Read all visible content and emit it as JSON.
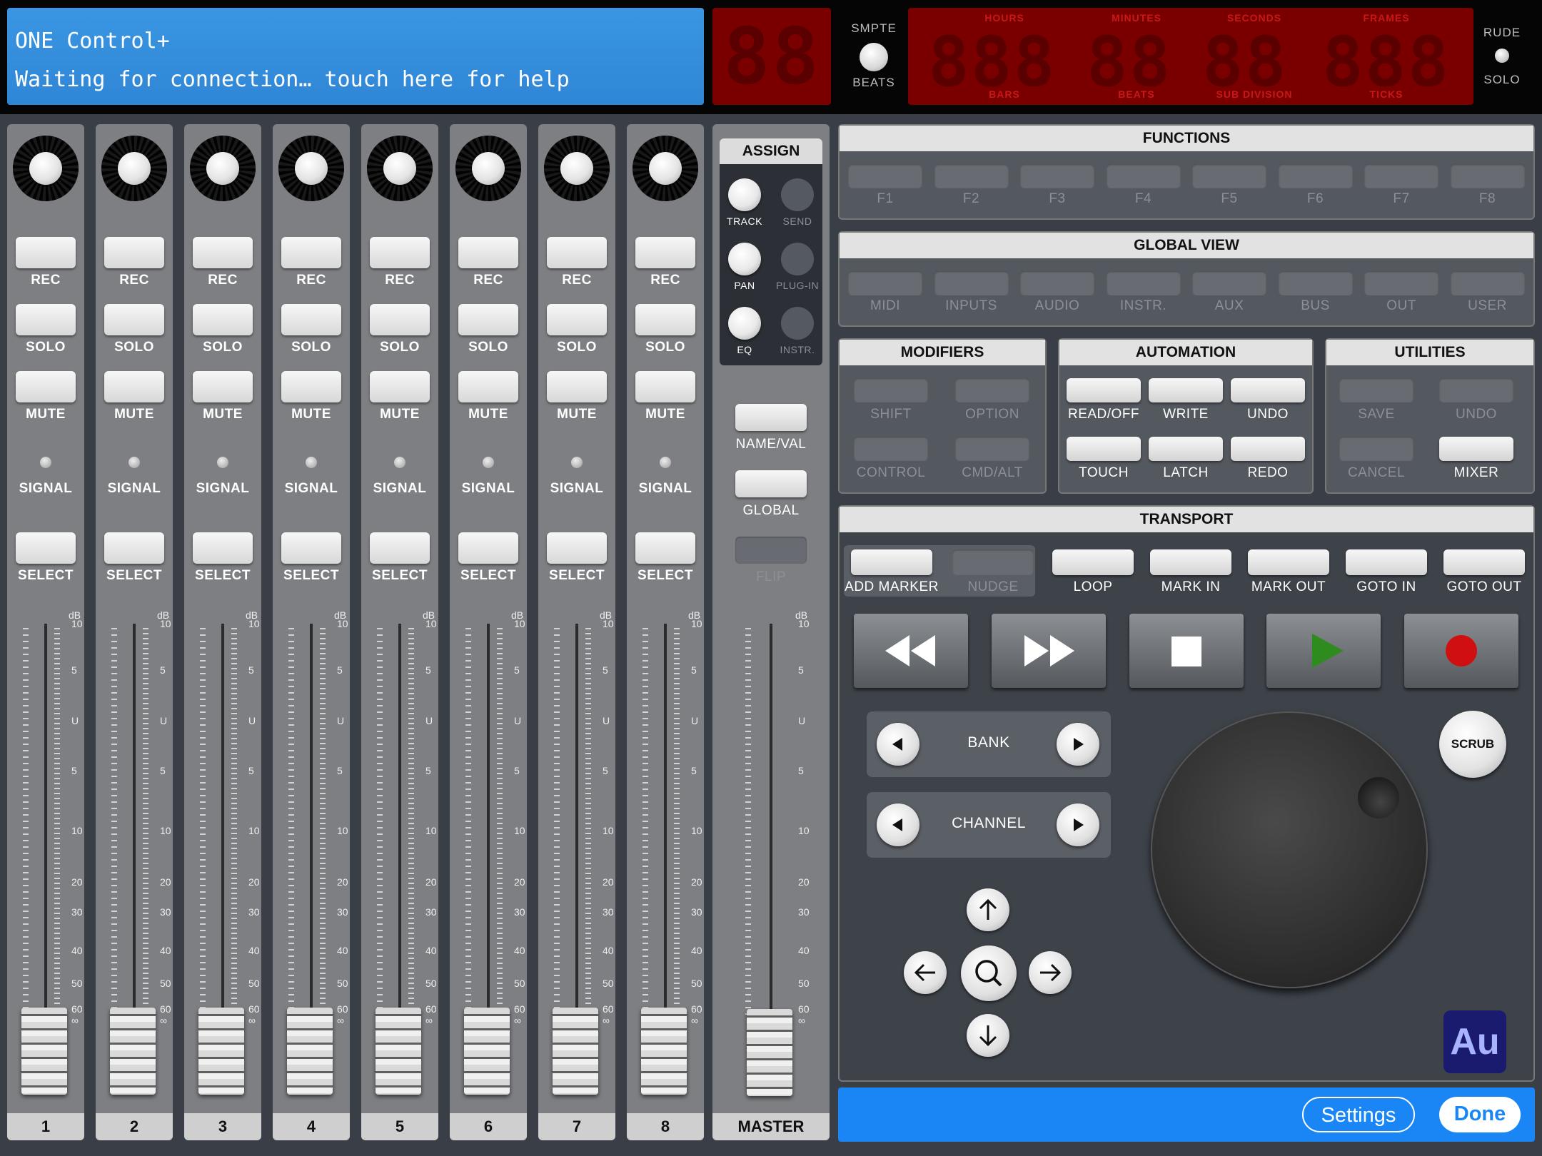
{
  "lcd": {
    "line1": "ONE Control+",
    "line2": "Waiting for connection… touch here for help"
  },
  "assign_display": "88",
  "timecode": {
    "top_labels": [
      "HOURS",
      "MINUTES",
      "SECONDS",
      "FRAMES"
    ],
    "bottom_labels": [
      "BARS",
      "BEATS",
      "SUB DIVISION",
      "TICKS"
    ],
    "groups": [
      "888",
      "88",
      "88",
      "888"
    ]
  },
  "smpte_toggle": {
    "top": "SMPTE",
    "bottom": "BEATS"
  },
  "rude_toggle": {
    "top": "RUDE",
    "bottom": "SOLO"
  },
  "channel_buttons": {
    "rec": "REC",
    "solo": "SOLO",
    "mute": "MUTE",
    "signal": "SIGNAL",
    "select": "SELECT"
  },
  "channels": [
    {
      "number": "1",
      "fader": 0.0
    },
    {
      "number": "2",
      "fader": 0.0
    },
    {
      "number": "3",
      "fader": 0.0
    },
    {
      "number": "4",
      "fader": 0.0
    },
    {
      "number": "5",
      "fader": 0.0
    },
    {
      "number": "6",
      "fader": 0.0
    },
    {
      "number": "7",
      "fader": 0.0
    },
    {
      "number": "8",
      "fader": 0.0
    }
  ],
  "fader_scale": {
    "db_label": "dB",
    "marks": [
      "10",
      "5",
      "U",
      "5",
      "10",
      "20",
      "30",
      "40",
      "50",
      "60",
      "∞"
    ]
  },
  "master": {
    "label": "MASTER",
    "fader": 0.0
  },
  "assign": {
    "title": "ASSIGN",
    "buttons": [
      {
        "label": "TRACK",
        "active": true
      },
      {
        "label": "SEND",
        "active": false
      },
      {
        "label": "PAN",
        "active": true
      },
      {
        "label": "PLUG-IN",
        "active": false
      },
      {
        "label": "EQ",
        "active": true
      },
      {
        "label": "INSTR.",
        "active": false
      }
    ]
  },
  "side_buttons": [
    {
      "label": "NAME/VAL",
      "active": true
    },
    {
      "label": "GLOBAL",
      "active": true
    },
    {
      "label": "FLIP",
      "active": false
    }
  ],
  "functions": {
    "title": "FUNCTIONS",
    "buttons": [
      "F1",
      "F2",
      "F3",
      "F4",
      "F5",
      "F6",
      "F7",
      "F8"
    ]
  },
  "global_view": {
    "title": "GLOBAL VIEW",
    "buttons": [
      "MIDI",
      "INPUTS",
      "AUDIO",
      "INSTR.",
      "AUX",
      "BUS",
      "OUT",
      "USER"
    ]
  },
  "modifiers": {
    "title": "MODIFIERS",
    "buttons": [
      {
        "label": "SHIFT",
        "active": false
      },
      {
        "label": "OPTION",
        "active": false
      },
      {
        "label": "CONTROL",
        "active": false
      },
      {
        "label": "CMD/ALT",
        "active": false
      }
    ]
  },
  "automation": {
    "title": "AUTOMATION",
    "buttons": [
      {
        "label": "READ/OFF",
        "active": true
      },
      {
        "label": "WRITE",
        "active": true
      },
      {
        "label": "UNDO",
        "active": true
      },
      {
        "label": "TOUCH",
        "active": true
      },
      {
        "label": "LATCH",
        "active": true
      },
      {
        "label": "REDO",
        "active": true
      }
    ]
  },
  "utilities": {
    "title": "UTILITIES",
    "buttons": [
      {
        "label": "SAVE",
        "active": false
      },
      {
        "label": "UNDO",
        "active": false
      },
      {
        "label": "CANCEL",
        "active": false
      },
      {
        "label": "MIXER",
        "active": true
      }
    ]
  },
  "transport": {
    "title": "TRANSPORT",
    "top_buttons": [
      {
        "label": "ADD MARKER",
        "active": true
      },
      {
        "label": "NUDGE",
        "active": false
      },
      {
        "label": "LOOP",
        "active": true
      },
      {
        "label": "MARK IN",
        "active": true
      },
      {
        "label": "MARK OUT",
        "active": true
      },
      {
        "label": "GOTO IN",
        "active": true
      },
      {
        "label": "GOTO OUT",
        "active": true
      }
    ],
    "play_color": "#2e8b1e",
    "record_color": "#d01010"
  },
  "bank": {
    "label": "BANK"
  },
  "channel_nav": {
    "label": "CHANNEL"
  },
  "scrub": {
    "label": "SCRUB"
  },
  "app_badge": {
    "label": "Au"
  },
  "bottom": {
    "settings": "Settings",
    "done": "Done"
  },
  "colors": {
    "lcd": "#2f86d6",
    "led_display": "#7a0000",
    "bottom_bar": "#1a86f5"
  }
}
